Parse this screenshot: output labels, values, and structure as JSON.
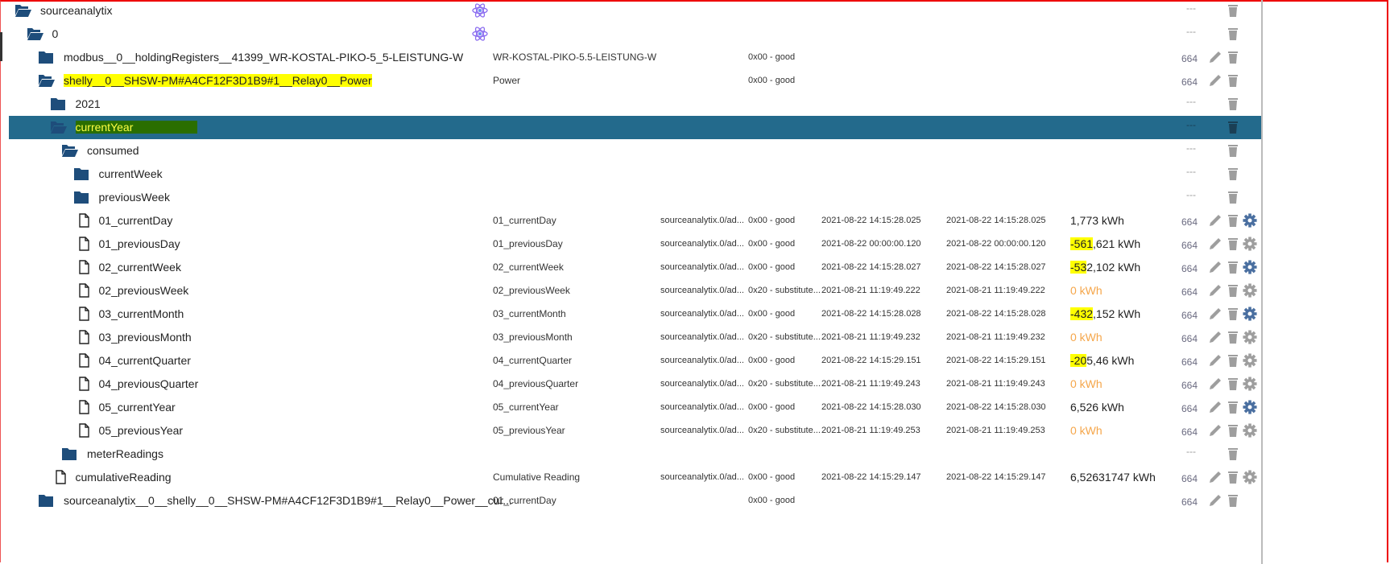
{
  "colors": {
    "folder": "#1e4d7b",
    "selected_bg": "#236a8c",
    "gear_active": "#4a6fa0",
    "gear_inactive": "#9e9e9e",
    "orange": "#f5a64a"
  },
  "rows": [
    {
      "level": 0,
      "icon": "folder-open",
      "name": "sourceanalytix",
      "atom": true,
      "acl": "---"
    },
    {
      "level": 1,
      "icon": "folder-open",
      "name": "0",
      "atom": true,
      "acl": "---"
    },
    {
      "level": 2,
      "icon": "folder",
      "name": "modbus__0__holdingRegisters__41399_WR-KOSTAL-PIKO-5_5-LEISTUNG-W",
      "desc": "WR-KOSTAL-PIKO-5.5-LEISTUNG-W",
      "status": "0x00 - good",
      "acl": "664",
      "pencil": true
    },
    {
      "level": 2,
      "icon": "folder-open",
      "name": "shelly__0__SHSW-PM#A4CF12F3D1B9#1__Relay0__Power",
      "name_hl": "yellow",
      "desc": "Power",
      "status": "0x00 - good",
      "acl": "664",
      "pencil": true
    },
    {
      "level": 3,
      "icon": "folder",
      "name": "2021",
      "acl": "---"
    },
    {
      "level": 3,
      "icon": "folder-open",
      "name": "currentYear",
      "name_hl": "green",
      "selected": true,
      "acl": "---"
    },
    {
      "level": 4,
      "icon": "folder-open",
      "name": "consumed",
      "acl": "---"
    },
    {
      "level": 5,
      "icon": "folder",
      "name": "currentWeek",
      "acl": "---"
    },
    {
      "level": 5,
      "icon": "folder",
      "name": "previousWeek",
      "acl": "---"
    },
    {
      "level": 5,
      "icon": "file",
      "name": "01_currentDay",
      "desc": "01_currentDay",
      "role": "sourceanalytix.0/ad...",
      "status": "0x00 - good",
      "ts": "2021-08-22 14:15:28.025",
      "lc": "2021-08-22 14:15:28.025",
      "value_hl": "",
      "value": "1,773 kWh",
      "acl": "664",
      "pencil": true,
      "gear": "active"
    },
    {
      "level": 5,
      "icon": "file",
      "name": "01_previousDay",
      "desc": "01_previousDay",
      "role": "sourceanalytix.0/ad...",
      "status": "0x00 - good",
      "ts": "2021-08-22 00:00:00.120",
      "lc": "2021-08-22 00:00:00.120",
      "value_hl": "-561",
      "value": ",621 kWh",
      "acl": "664",
      "pencil": true,
      "gear": "inactive"
    },
    {
      "level": 5,
      "icon": "file",
      "name": "02_currentWeek",
      "desc": "02_currentWeek",
      "role": "sourceanalytix.0/ad...",
      "status": "0x00 - good",
      "ts": "2021-08-22 14:15:28.027",
      "lc": "2021-08-22 14:15:28.027",
      "value_hl": "-53",
      "value": "2,102 kWh",
      "acl": "664",
      "pencil": true,
      "gear": "active"
    },
    {
      "level": 5,
      "icon": "file",
      "name": "02_previousWeek",
      "desc": "02_previousWeek",
      "role": "sourceanalytix.0/ad...",
      "status": "0x20 - substitute...",
      "ts": "2021-08-21 11:19:49.222",
      "lc": "2021-08-21 11:19:49.222",
      "value_hl": "",
      "value": "0 kWh",
      "orange": true,
      "acl": "664",
      "pencil": true,
      "gear": "inactive"
    },
    {
      "level": 5,
      "icon": "file",
      "name": "03_currentMonth",
      "desc": "03_currentMonth",
      "role": "sourceanalytix.0/ad...",
      "status": "0x00 - good",
      "ts": "2021-08-22 14:15:28.028",
      "lc": "2021-08-22 14:15:28.028",
      "value_hl": "-432",
      "value": ",152 kWh",
      "acl": "664",
      "pencil": true,
      "gear": "active"
    },
    {
      "level": 5,
      "icon": "file",
      "name": "03_previousMonth",
      "desc": "03_previousMonth",
      "role": "sourceanalytix.0/ad...",
      "status": "0x20 - substitute...",
      "ts": "2021-08-21 11:19:49.232",
      "lc": "2021-08-21 11:19:49.232",
      "value_hl": "",
      "value": "0 kWh",
      "orange": true,
      "acl": "664",
      "pencil": true,
      "gear": "inactive"
    },
    {
      "level": 5,
      "icon": "file",
      "name": "04_currentQuarter",
      "desc": "04_currentQuarter",
      "role": "sourceanalytix.0/ad...",
      "status": "0x00 - good",
      "ts": "2021-08-22 14:15:29.151",
      "lc": "2021-08-22 14:15:29.151",
      "value_hl": "-20",
      "value": "5,46 kWh",
      "acl": "664",
      "pencil": true,
      "gear": "inactive"
    },
    {
      "level": 5,
      "icon": "file",
      "name": "04_previousQuarter",
      "desc": "04_previousQuarter",
      "role": "sourceanalytix.0/ad...",
      "status": "0x20 - substitute...",
      "ts": "2021-08-21 11:19:49.243",
      "lc": "2021-08-21 11:19:49.243",
      "value_hl": "",
      "value": "0 kWh",
      "orange": true,
      "acl": "664",
      "pencil": true,
      "gear": "inactive"
    },
    {
      "level": 5,
      "icon": "file",
      "name": "05_currentYear",
      "desc": "05_currentYear",
      "role": "sourceanalytix.0/ad...",
      "status": "0x00 - good",
      "ts": "2021-08-22 14:15:28.030",
      "lc": "2021-08-22 14:15:28.030",
      "value_hl": "",
      "value": "6,526 kWh",
      "acl": "664",
      "pencil": true,
      "gear": "active"
    },
    {
      "level": 5,
      "icon": "file",
      "name": "05_previousYear",
      "desc": "05_previousYear",
      "role": "sourceanalytix.0/ad...",
      "status": "0x20 - substitute...",
      "ts": "2021-08-21 11:19:49.253",
      "lc": "2021-08-21 11:19:49.253",
      "value_hl": "",
      "value": "0 kWh",
      "orange": true,
      "acl": "664",
      "pencil": true,
      "gear": "inactive"
    },
    {
      "level": 4,
      "icon": "folder",
      "name": "meterReadings",
      "acl": "---"
    },
    {
      "level": 3,
      "icon": "file",
      "name": "cumulativeReading",
      "desc": "Cumulative Reading",
      "role": "sourceanalytix.0/ad...",
      "status": "0x00 - good",
      "ts": "2021-08-22 14:15:29.147",
      "lc": "2021-08-22 14:15:29.147",
      "value_hl": "",
      "value": "6,52631747 kWh",
      "acl": "664",
      "pencil": true,
      "gear": "inactive"
    },
    {
      "level": 2,
      "icon": "folder",
      "name": "sourceanalytix__0__shelly__0__SHSW-PM#A4CF12F3D1B9#1__Relay0__Power__cur...",
      "desc": "01_currentDay",
      "status": "0x00 - good",
      "acl": "664",
      "pencil": true
    }
  ]
}
